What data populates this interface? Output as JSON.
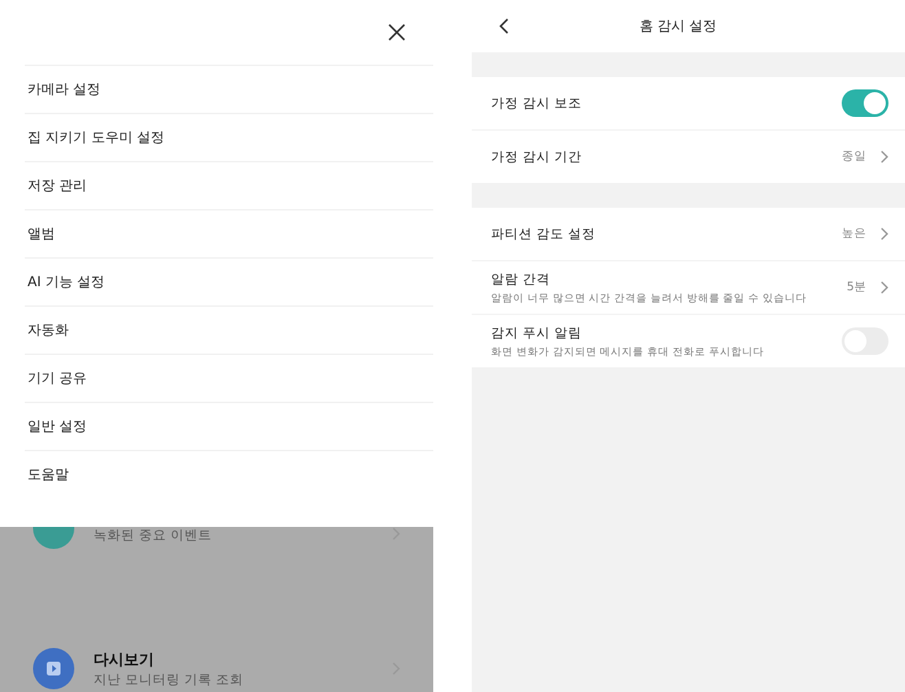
{
  "menu": {
    "items": [
      "카메라 설정",
      "집 지키기 도우미 설정",
      "저장 관리",
      "앨범",
      "AI 기능 설정",
      "자동화",
      "기기 공유",
      "일반 설정",
      "도움말"
    ]
  },
  "background_list": [
    {
      "kind": "events",
      "subtitle": "녹화된 중요 이벤트"
    },
    {
      "kind": "playback",
      "title": "다시보기",
      "subtitle": "지난 모니터링 기록 조회"
    }
  ],
  "settings": {
    "title": "홈 감시 설정",
    "groups": [
      [
        {
          "kind": "toggle",
          "label": "가정 감시 보조",
          "on": true
        },
        {
          "kind": "value",
          "label": "가정 감시 기간",
          "value": "종일"
        }
      ],
      [
        {
          "kind": "value",
          "label": "파티션 감도 설정",
          "value": "높은"
        },
        {
          "kind": "value",
          "label": "알람 간격",
          "description": "알람이 너무 많으면 시간 간격을 늘려서 방해를 줄일 수 있습니다",
          "value": "5분"
        },
        {
          "kind": "toggle",
          "label": "감지 푸시 알림",
          "description": "화면 변화가 감지되면 메시지를 휴대 전화로 푸시합니다",
          "on": false
        }
      ]
    ]
  }
}
